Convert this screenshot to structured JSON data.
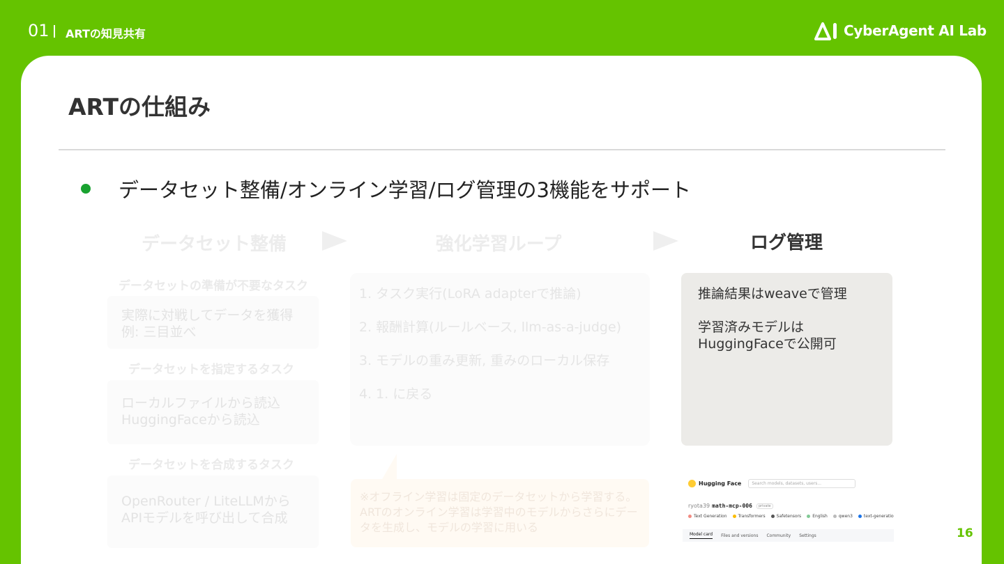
{
  "header": {
    "section_number": "01",
    "section_title": "ARTの知見共有",
    "brand": "CyberAgent AI Lab"
  },
  "slide": {
    "title": "ARTの仕組み",
    "bullet": "データセット整備/オンライン学習/ログ管理の3機能をサポート",
    "page_number": "16"
  },
  "columns": {
    "dataset": {
      "heading": "データセット整備",
      "groups": [
        {
          "label": "データセットの準備が不要なタスク",
          "lines": [
            "実際に対戦してデータを獲得",
            "例: 三目並べ"
          ]
        },
        {
          "label": "データセットを指定するタスク",
          "lines": [
            "ローカルファイルから読込",
            "HuggingFaceから読込"
          ]
        },
        {
          "label": "データセットを合成するタスク",
          "lines": [
            "OpenRouter / LiteLLMから",
            "APIモデルを呼び出して合成"
          ]
        }
      ]
    },
    "rl_loop": {
      "heading": "強化学習ループ",
      "steps": [
        "1. タスク実行(LoRA adapterで推論)",
        "2. 報酬計算(ルールベース, llm-as-a-judge)",
        "3. モデルの重み更新, 重みのローカル保存",
        "4. 1. に戻る"
      ],
      "note": "※オフライン学習は固定のデータセットから学習する。ARTのオンライン学習は学習中のモデルからさらにデータを生成し、モデルの学習に用いる"
    },
    "log": {
      "heading": "ログ管理",
      "lines": [
        "推論結果はweaveで管理",
        "学習済みモデルは",
        "HuggingFaceで公開可"
      ]
    }
  },
  "hf_screenshot": {
    "brand": "Hugging Face",
    "search_placeholder": "Search models, datasets, users...",
    "user": "ryota39",
    "model": "math-mcp-006",
    "visibility": "private",
    "tags": [
      {
        "label": "Text Generation",
        "color": "#f28b82"
      },
      {
        "label": "Transformers",
        "color": "#fbbc04"
      },
      {
        "label": "Safetensors",
        "color": "#555555"
      },
      {
        "label": "English",
        "color": "#81c995"
      },
      {
        "label": "qwen3",
        "color": "#bbbbbb"
      },
      {
        "label": "text-generation-inference",
        "color": "#1a73e8"
      }
    ],
    "tabs": [
      "Model card",
      "Files and versions",
      "Community",
      "Settings"
    ]
  },
  "colors": {
    "brand_green": "#65c300",
    "bullet_green": "#19a230",
    "log_box": "#ecebe8"
  }
}
